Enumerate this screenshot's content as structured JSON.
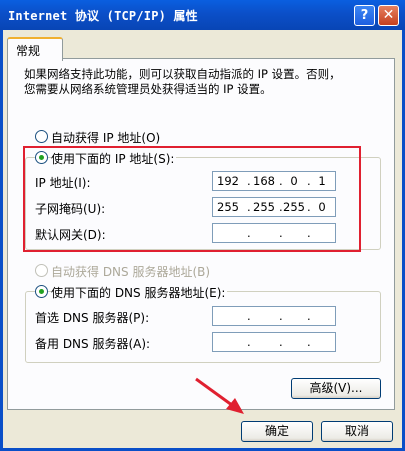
{
  "window": {
    "title": "Internet 协议 (TCP/IP) 属性",
    "help_btn": "?",
    "close_btn": "✕"
  },
  "tabs": [
    {
      "label": "常规"
    }
  ],
  "intro": {
    "line1": "如果网络支持此功能，则可以获取自动指派的 IP 设置。否则，",
    "line2": "您需要从网络系统管理员处获得适当的 IP 设置。"
  },
  "ip_section": {
    "auto_label": "自动获得 IP 地址(O)",
    "manual_label": "使用下面的 IP 地址(S):",
    "selected": "manual",
    "fields": [
      {
        "label": "IP 地址(I):",
        "value": [
          "192",
          "168",
          "0",
          "1"
        ]
      },
      {
        "label": "子网掩码(U):",
        "value": [
          "255",
          "255",
          "255",
          "0"
        ]
      },
      {
        "label": "默认网关(D):",
        "value": [
          "",
          "",
          "",
          ""
        ]
      }
    ]
  },
  "dns_section": {
    "auto_label": "自动获得 DNS 服务器地址(B)",
    "manual_label": "使用下面的 DNS 服务器地址(E):",
    "selected": "manual",
    "fields": [
      {
        "label": "首选 DNS 服务器(P):",
        "value": [
          "",
          "",
          "",
          ""
        ]
      },
      {
        "label": "备用 DNS 服务器(A):",
        "value": [
          "",
          "",
          "",
          ""
        ]
      }
    ]
  },
  "buttons": {
    "advanced": "高级(V)...",
    "ok": "确定",
    "cancel": "取消"
  },
  "colors": {
    "highlight_box": "#e02030",
    "arrow": "#e02030",
    "title_bar": "#0a5fe0"
  }
}
